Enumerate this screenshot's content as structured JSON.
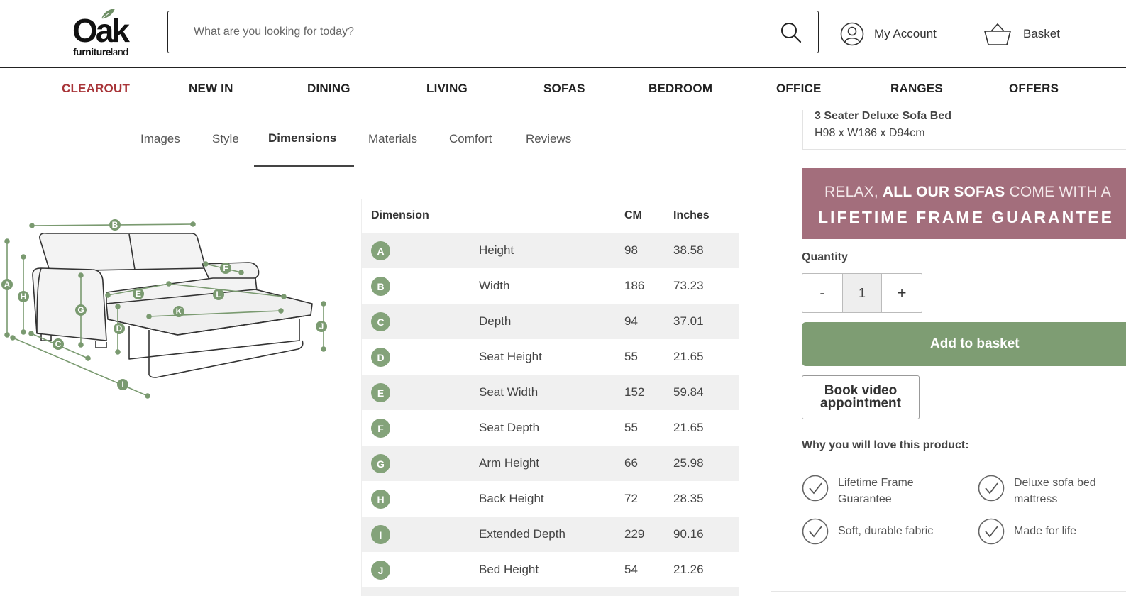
{
  "header": {
    "logo": {
      "word": "Oak",
      "sub_bold": "furniture",
      "sub_regular": "land"
    },
    "search_placeholder": "What are you looking for today?",
    "account_label": "My Account",
    "basket_label": "Basket"
  },
  "nav": [
    "CLEAROUT",
    "NEW IN",
    "DINING",
    "LIVING",
    "SOFAS",
    "BEDROOM",
    "OFFICE",
    "RANGES",
    "OFFERS"
  ],
  "tabs": [
    "Images",
    "Style",
    "Dimensions",
    "Materials",
    "Comfort",
    "Reviews"
  ],
  "active_tab": "Dimensions",
  "table": {
    "headers": {
      "dimension": "Dimension",
      "cm": "CM",
      "inches": "Inches"
    },
    "rows": [
      {
        "letter": "A",
        "name": "Height",
        "cm": "98",
        "inches": "38.58"
      },
      {
        "letter": "B",
        "name": "Width",
        "cm": "186",
        "inches": "73.23"
      },
      {
        "letter": "C",
        "name": "Depth",
        "cm": "94",
        "inches": "37.01"
      },
      {
        "letter": "D",
        "name": "Seat Height",
        "cm": "55",
        "inches": "21.65"
      },
      {
        "letter": "E",
        "name": "Seat Width",
        "cm": "152",
        "inches": "59.84"
      },
      {
        "letter": "F",
        "name": "Seat Depth",
        "cm": "55",
        "inches": "21.65"
      },
      {
        "letter": "G",
        "name": "Arm Height",
        "cm": "66",
        "inches": "25.98"
      },
      {
        "letter": "H",
        "name": "Back Height",
        "cm": "72",
        "inches": "28.35"
      },
      {
        "letter": "I",
        "name": "Extended Depth",
        "cm": "229",
        "inches": "90.16"
      },
      {
        "letter": "J",
        "name": "Bed Height",
        "cm": "54",
        "inches": "21.26"
      }
    ]
  },
  "diagram_labels": [
    "A",
    "B",
    "C",
    "D",
    "E",
    "F",
    "G",
    "H",
    "I",
    "J",
    "K",
    "L"
  ],
  "product": {
    "name": "3 Seater Deluxe Sofa Bed",
    "dimensions": "H98 x W186 x D94cm"
  },
  "promo": {
    "line1_pre": "RELAX, ",
    "line1_bold": "ALL OUR SOFAS",
    "line1_post": " COME WITH A",
    "line2": "LIFETIME FRAME GUARANTEE"
  },
  "quantity": {
    "label": "Quantity",
    "minus": "-",
    "value": "1",
    "plus": "+"
  },
  "add_to_basket": "Add to basket",
  "book_video": "Book video appointment",
  "why_title": "Why you will love this product:",
  "features": [
    "Lifetime Frame Guarantee",
    "Deluxe sofa bed mattress",
    "Soft, durable fabric",
    "Made for life"
  ],
  "colors": {
    "accent_green": "#7e9d73",
    "badge_green": "#84a37a",
    "clearout_red": "#a83438",
    "promo_bg": "#a36e7c"
  }
}
